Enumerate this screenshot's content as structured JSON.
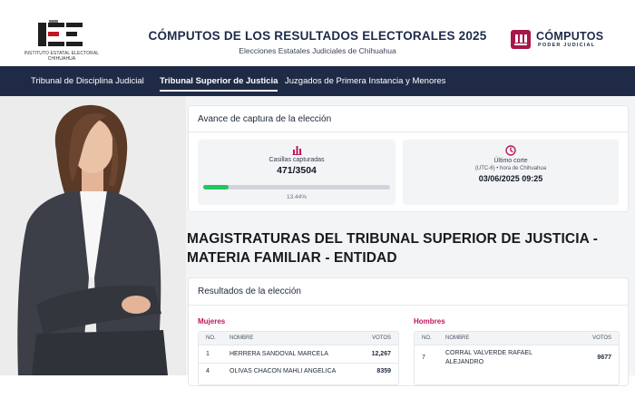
{
  "header": {
    "institute_logo_text": "INSTITUTO ESTATAL ELECTORAL CHIHUAHUA",
    "title": "CÓMPUTOS DE LOS RESULTADOS ELECTORALES 2025",
    "subtitle": "Elecciones Estatales Judiciales de Chihuahua",
    "brand_name": "CÓMPUTOS",
    "brand_sub": "PODER JUDICIAL"
  },
  "nav": {
    "tabs": [
      {
        "label": "Tribunal de Disciplina Judicial",
        "active": false
      },
      {
        "label": "Tribunal Superior de Justicia",
        "active": true
      },
      {
        "label": "Juzgados de Primera Instancia y Menores",
        "active": false
      }
    ]
  },
  "progress": {
    "title": "Avance de captura de la elección",
    "casillas_label": "Casillas capturadas",
    "casillas_value": "471/3504",
    "percent_label": "13.44%",
    "percent": 13.44,
    "corte_label": "Último corte",
    "corte_tz": "(UTC-6) • hora de Chihuahua",
    "corte_value": "03/06/2025 09:25"
  },
  "section": {
    "title": "MAGISTRATURAS DEL TRIBUNAL SUPERIOR DE JUSTICIA - MATERIA FAMILIAR - ENTIDAD"
  },
  "results": {
    "title": "Resultados de la elección",
    "columns": {
      "no": "NO.",
      "name": "NOMBRE",
      "votes": "VOTOS"
    },
    "women": {
      "label": "Mujeres",
      "rows": [
        {
          "no": "1",
          "name": "HERRERA SANDOVAL MARCELA",
          "votes": "12,267"
        },
        {
          "no": "4",
          "name": "OLIVAS CHACON MAHLI ANGELICA",
          "votes": "8359"
        }
      ]
    },
    "men": {
      "label": "Hombres",
      "rows": [
        {
          "no": "7",
          "name_line1": "CORRAL VALVERDE RAFAEL",
          "name_line2": "ALEJANDRO",
          "votes": "9677"
        }
      ]
    }
  },
  "colors": {
    "nav_bg": "#1f2b46",
    "accent_pink": "#be185d",
    "brand_red": "#a8174a",
    "progress_green": "#22c55e"
  }
}
